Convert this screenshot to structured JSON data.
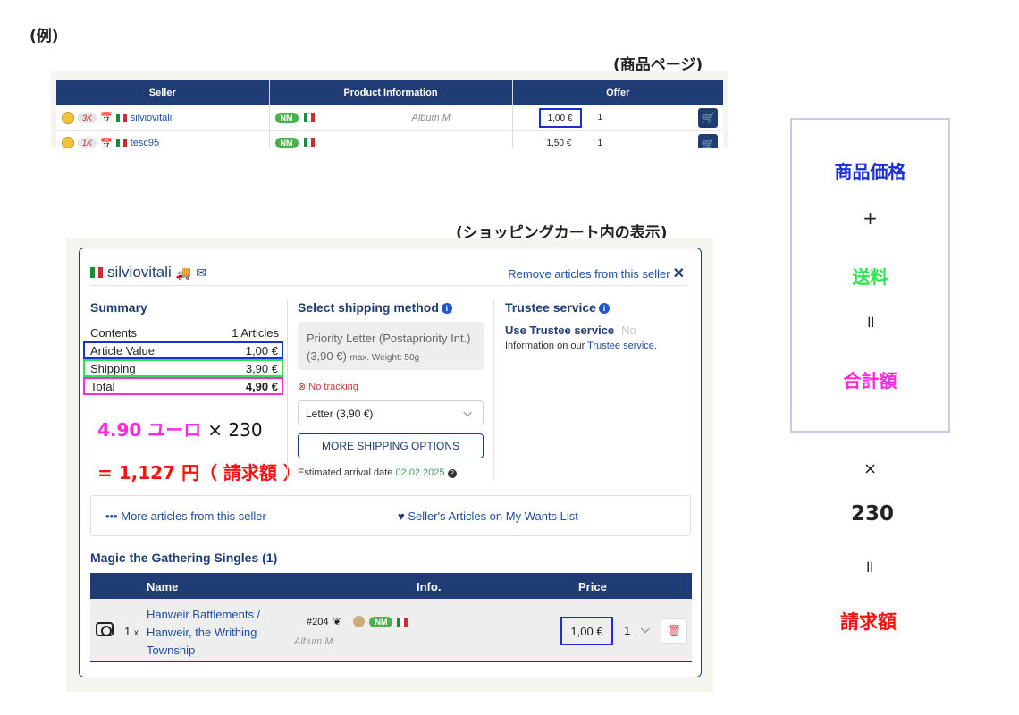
{
  "labels": {
    "example": "(例)",
    "product_page": "(商品ページ)",
    "cart": "(ショッピングカート内の表示)"
  },
  "colors": {
    "accent_blue": "#1a2fd8",
    "accent_green": "#27e84b",
    "accent_magenta": "#ff2ae0",
    "accent_red": "#ff1111",
    "brand_navy": "#1f3c74"
  },
  "product_table": {
    "headers": [
      "Seller",
      "Product Information",
      "Offer"
    ],
    "rows": [
      {
        "sales": "3K",
        "seller": "silviovitali",
        "condition": "NM",
        "album": "Album M",
        "price": "1,00 €",
        "qty": "1"
      },
      {
        "sales": "1K",
        "seller": "tesc95",
        "condition": "NM",
        "album": "",
        "price": "1,50 €",
        "qty": "1"
      }
    ]
  },
  "cart": {
    "seller_name": "silviovitali",
    "remove_link": "Remove articles from this seller",
    "summary": {
      "title": "Summary",
      "rows": [
        {
          "label": "Contents",
          "value": "1 Articles"
        },
        {
          "label": "Article Value",
          "value": "1,00 €"
        },
        {
          "label": "Shipping",
          "value": "3,90 €"
        },
        {
          "label": "Total",
          "value": "4,90 €"
        }
      ]
    },
    "shipping": {
      "title": "Select shipping method",
      "method_text": "Priority Letter (Postapriority Int.) (3,90 €)",
      "method_weight": "max. Weight: 50g",
      "no_tracking": "No tracking",
      "select_value": "Letter (3,90 €)",
      "more_button": "MORE SHIPPING OPTIONS",
      "arrival_label": "Estimated arrival date",
      "arrival_date": "02.02.2025"
    },
    "trustee": {
      "title": "Trustee service",
      "use_label": "Use Trustee service",
      "use_value": "No",
      "info_prefix": "Information on our",
      "info_link": "Trustee service."
    },
    "calc": {
      "line1_amount": "4.90 ユーロ",
      "line1_times": "× 230",
      "line2": "= 1,127 円（ 請求額 ）"
    },
    "links": {
      "more_articles": "••• More articles from this seller",
      "wants_list": "Seller's Articles on My Wants List"
    },
    "singles": {
      "title": "Magic the Gathering Singles (1)",
      "headers": {
        "name": "Name",
        "info": "Info.",
        "price": "Price"
      },
      "item": {
        "qty_prefix": "1",
        "qty_x": "x",
        "name": "Hanweir Battlements / Hanweir, the Writhing Township",
        "number": "#204",
        "condition": "NM",
        "album": "Album M",
        "price": "1,00 €",
        "qty": "1"
      }
    }
  },
  "formula": {
    "item_price": "商品価格",
    "plus": "+",
    "shipping": "送料",
    "equals": "॥",
    "total": "合計額",
    "times": "×",
    "multiplier": "230",
    "equals2": "॥",
    "bill": "請求額"
  }
}
